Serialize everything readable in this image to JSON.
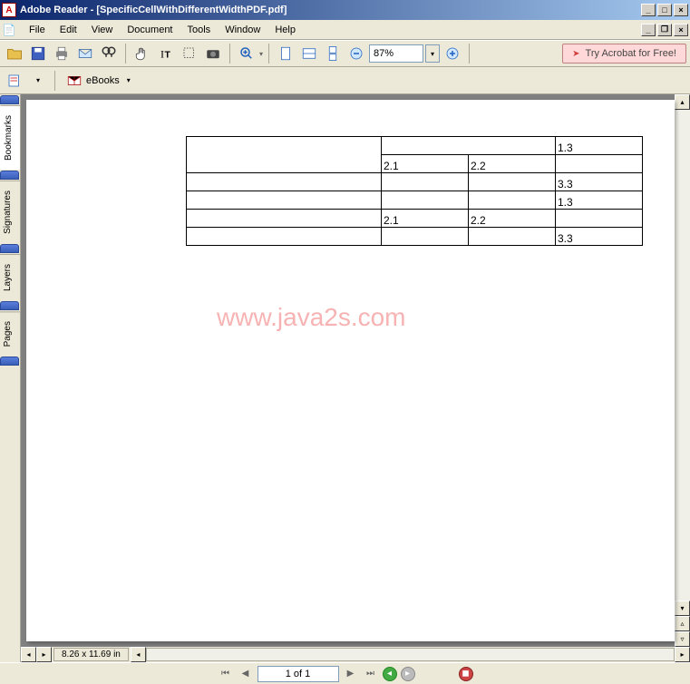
{
  "titlebar": {
    "app": "Adobe Reader",
    "doc": "[SpecificCellWithDifferentWidthPDF.pdf]"
  },
  "menu": [
    "File",
    "Edit",
    "View",
    "Document",
    "Tools",
    "Window",
    "Help"
  ],
  "toolbar": {
    "zoom": "87%",
    "promo": "Try Acrobat for Free!"
  },
  "toolbar2": {
    "ebooks": "eBooks"
  },
  "sidebar": {
    "tabs": [
      "Bookmarks",
      "Signatures",
      "Layers",
      "Pages"
    ]
  },
  "document": {
    "table": [
      {
        "a": "",
        "b": "",
        "c": "",
        "d": "1.3"
      },
      {
        "a": "",
        "b": "2.1",
        "c": "2.2",
        "d": ""
      },
      {
        "a": "",
        "b": "",
        "c": "",
        "d": "3.3"
      },
      {
        "a": "",
        "b": "",
        "c": "",
        "d": "1.3"
      },
      {
        "a": "",
        "b": "2.1",
        "c": "2.2",
        "d": ""
      },
      {
        "a": "",
        "b": "",
        "c": "",
        "d": "3.3"
      }
    ],
    "watermark": "www.java2s.com"
  },
  "footer": {
    "dims": "8.26 x 11.69 in",
    "page": "1 of 1"
  }
}
